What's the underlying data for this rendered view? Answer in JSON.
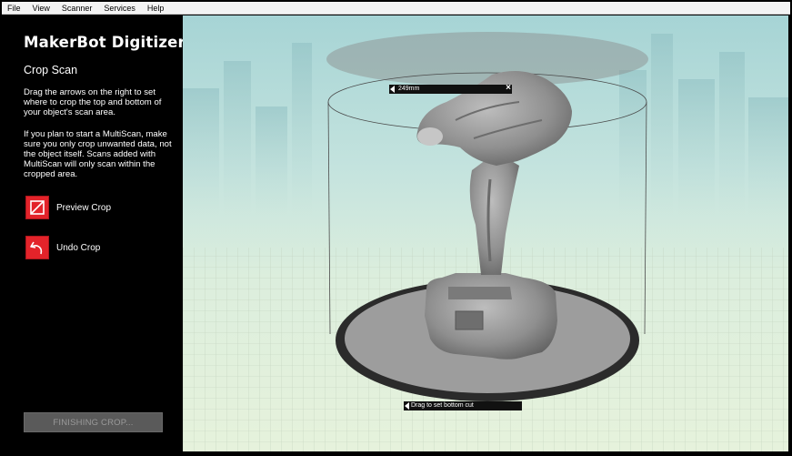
{
  "menu": [
    "File",
    "View",
    "Scanner",
    "Services",
    "Help"
  ],
  "sidebar": {
    "logo": "MakerBot Digitizer",
    "step_title": "Crop Scan",
    "instructions": "Drag the arrows on the right to set where to crop the top and bottom of your object's scan area.",
    "multiscan_note": "If you plan to start a MultiScan, make sure you only crop unwanted data, not the object itself. Scans added with MultiScan will only scan within the cropped area.",
    "preview_crop_label": "Preview Crop",
    "undo_crop_label": "Undo Crop",
    "finishing_label": "FINISHING CROP..."
  },
  "viewport": {
    "top_cut_value": "249mm",
    "top_close_symbol": "×",
    "bottom_hint": "Drag to set bottom cut"
  },
  "icons": {
    "preview": "crop-icon",
    "undo": "undo-arrow-icon",
    "accent_color": "#e3232a"
  }
}
